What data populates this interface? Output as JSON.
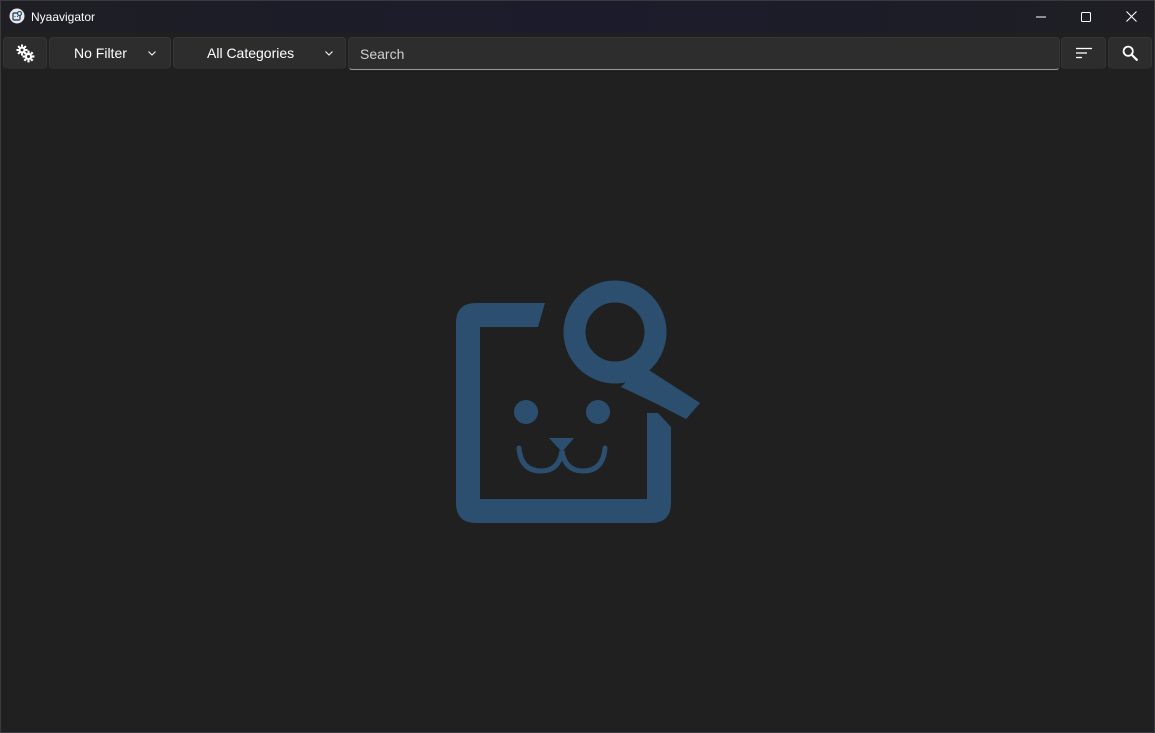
{
  "window": {
    "title": "Nyaavigator",
    "controls": {
      "minimize": "minimize-icon",
      "maximize": "maximize-icon",
      "close": "close-icon"
    }
  },
  "toolbar": {
    "settings_icon": "gears-icon",
    "filter": {
      "selected": "No Filter"
    },
    "category": {
      "selected": "All Categories"
    },
    "search": {
      "placeholder": "Search",
      "value": ""
    },
    "sort_icon": "sort-icon",
    "search_icon": "search-icon"
  },
  "empty_state": {
    "logo": "nyaavigator-cat-search-logo",
    "logo_color": "#2c4f70"
  },
  "colors": {
    "background": "#202020",
    "control": "#2d2d2d",
    "accent": "#2c4f70"
  }
}
